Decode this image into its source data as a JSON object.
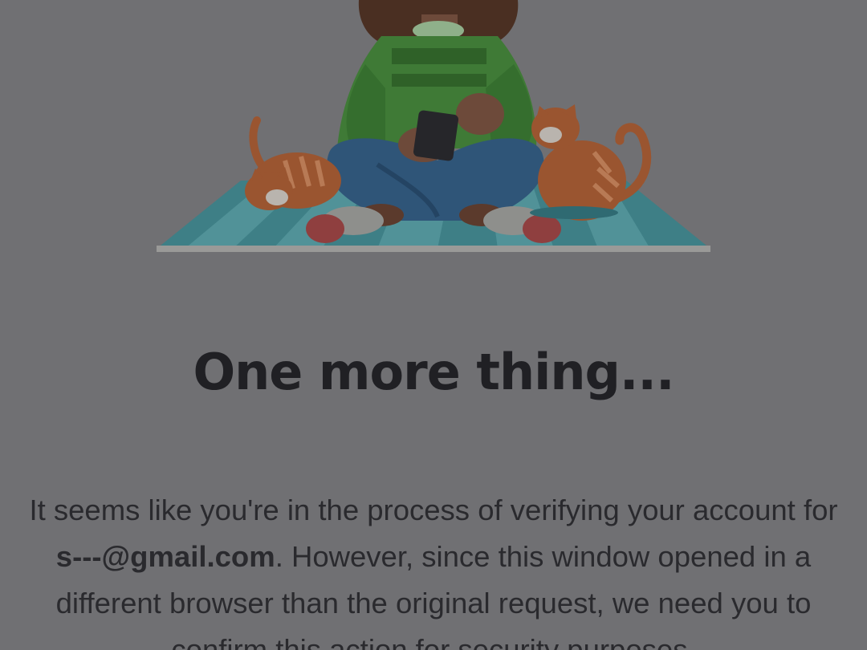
{
  "dialog": {
    "title": "One more thing...",
    "message": {
      "before_email": "It seems like you're in the process of verifying your account for ",
      "email": "s---@gmail.com",
      "after_email": ". However, since this window opened in a different browser than the original request, we need you to confirm this action for security purposes."
    }
  },
  "colors": {
    "overlay": "#707073",
    "title_text": "#202024",
    "body_text": "#2a2a2e"
  },
  "illustration": {
    "subject": "person sitting on blanket with phone and two cats"
  }
}
